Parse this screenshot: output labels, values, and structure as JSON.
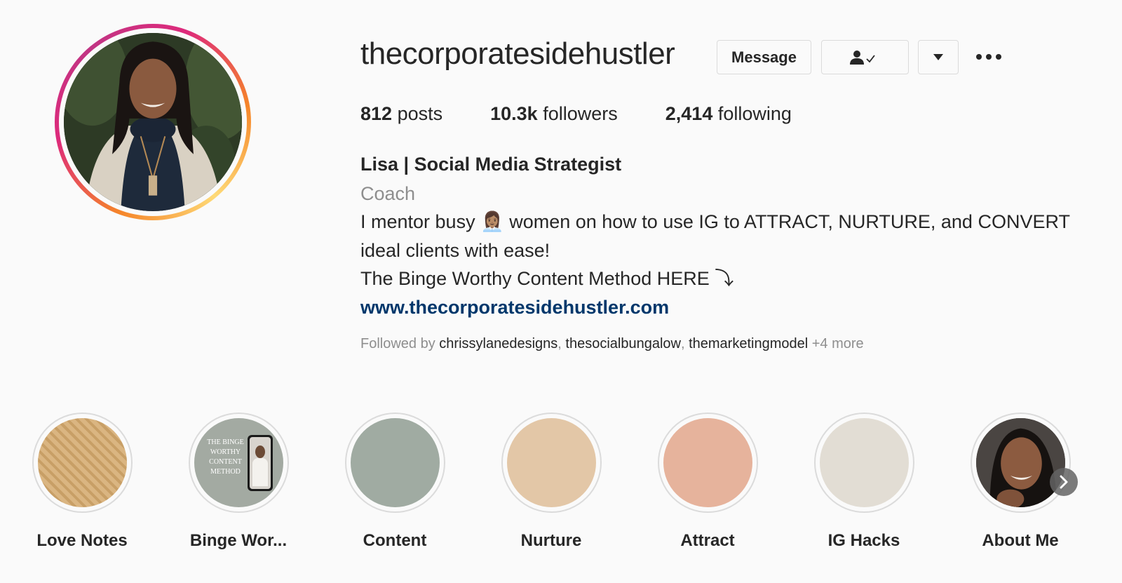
{
  "profile": {
    "username": "thecorporatesidehustler",
    "message_label": "Message",
    "following_icon": "person-check-icon",
    "dropdown_icon": "caret-down-icon",
    "more_icon": "ellipsis-icon"
  },
  "stats": {
    "posts_count": "812",
    "posts_label": "posts",
    "followers_count": "10.3k",
    "followers_label": "followers",
    "following_count": "2,414",
    "following_label": "following"
  },
  "bio": {
    "name": "Lisa | Social Media Strategist",
    "category": "Coach",
    "line1": "I mentor busy 👩🏽‍💼 women on how to use IG to ATTRACT, NURTURE, and CONVERT",
    "line2": "ideal clients with ease!",
    "line3": "The Binge Worthy Content Method HERE ⤵",
    "link": "www.thecorporatesidehustler.com"
  },
  "followed_by": {
    "prefix": "Followed by",
    "accounts": [
      "chrissylanedesigns",
      "thesocialbungalow",
      "themarketingmodel"
    ],
    "more": "+4 more"
  },
  "highlights": [
    {
      "label": "Love Notes",
      "color": "#e8d2ae"
    },
    {
      "label": "Binge Wor...",
      "color": "#a3aaa2",
      "cover_text": [
        "THE BINGE",
        "WORTHY",
        "CONTENT",
        "METHOD"
      ]
    },
    {
      "label": "Content",
      "color": "#a0aba2"
    },
    {
      "label": "Nurture",
      "color": "#e3c7a7"
    },
    {
      "label": "Attract",
      "color": "#e6b39c"
    },
    {
      "label": "IG Hacks",
      "color": "#e2ddd4"
    },
    {
      "label": "About Me",
      "color": "#5a4a40"
    }
  ],
  "colors": {
    "text": "#262626",
    "muted": "#8e8e8e",
    "link": "#00376b",
    "border": "#dbdbdb",
    "background": "#fafafa"
  }
}
